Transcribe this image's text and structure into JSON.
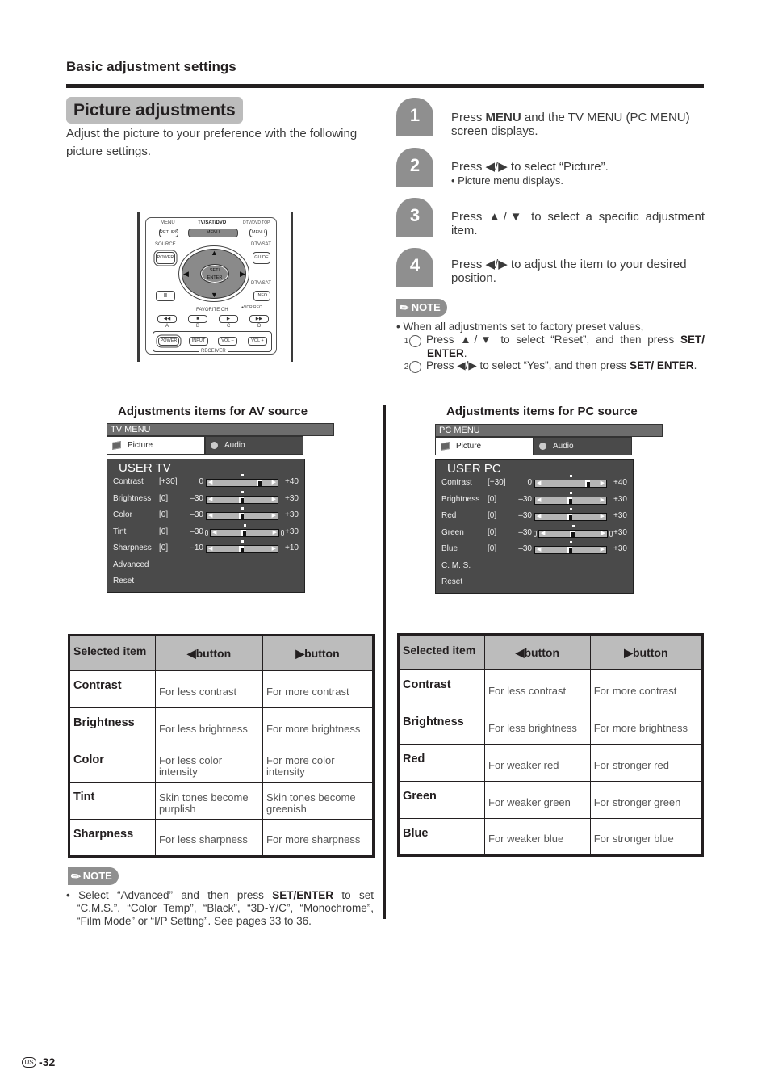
{
  "header": {
    "section_title": "Basic adjustment settings",
    "page_title": "Picture adjustments",
    "intro": "Adjust the picture to your preference with the following picture settings."
  },
  "remote": {
    "labels": {
      "menu_top": "MENU",
      "tvsatdvd": "TV/SAT/DVD",
      "dtvdvdtop": "DTV/DVD TOP",
      "source": "SOURCE",
      "dtvsat1": "DTV/SAT",
      "dtvsat2": "DTV/SAT",
      "favorite": "FAVORITE CH",
      "vcrrec": "●VCR REC",
      "a": "A",
      "b": "B",
      "c": "C",
      "d": "D",
      "receiver": "RECEIVER"
    },
    "buttons": {
      "return": "RETURN",
      "menu": "MENU",
      "menu_right": "MENU",
      "power_source": "POWER",
      "guide": "GUIDE",
      "set_enter": "SET/ ENTER",
      "pause": "II",
      "info": "INFO",
      "rew": "◀◀",
      "stop": "■",
      "play": "▶",
      "ff": "▶▶",
      "power_receiver": "POWER",
      "input": "INPUT",
      "vol_minus": "VOL –",
      "vol_plus": "VOL +",
      "up": "▲",
      "down": "▼",
      "left": "◀",
      "right": "▶"
    }
  },
  "steps": [
    {
      "num": "1",
      "pre": "Press ",
      "bold": "MENU",
      "post": " and the TV MENU (PC MENU) screen displays.",
      "sub": ""
    },
    {
      "num": "2",
      "pre": "Press ◀/▶ to select “Picture”.",
      "bold": "",
      "post": "",
      "sub": "• Picture menu displays."
    },
    {
      "num": "3",
      "pre": "Press ▲/▼ to select a specific adjustment item.",
      "bold": "",
      "post": "",
      "sub": ""
    },
    {
      "num": "4",
      "pre": "Press ◀/▶ to adjust the item to your desired position.",
      "bold": "",
      "post": "",
      "sub": ""
    }
  ],
  "note_top": {
    "badge": "NOTE",
    "intro": "• When all adjustments set to factory preset values,",
    "items": [
      {
        "num": "1",
        "pre": "Press ▲/▼ to select “Reset”, and then press ",
        "bold": "SET/ ENTER",
        "post": "."
      },
      {
        "num": "2",
        "pre": "Press ◀/▶ to select “Yes”, and then press ",
        "bold": "SET/ ENTER",
        "post": "."
      }
    ]
  },
  "av": {
    "heading": "Adjustments items for AV source",
    "menu": {
      "bar": "TV MENU",
      "tabs": [
        {
          "label": "Picture",
          "icon": "picture-icon",
          "active": true
        },
        {
          "label": "Audio",
          "icon": "audio-icon",
          "active": false
        }
      ],
      "mode": "USER TV",
      "sliders": [
        {
          "label": "Contrast",
          "bracket": "[+30]",
          "min": "0",
          "max": "+40",
          "value": 30,
          "range": [
            0,
            40
          ],
          "caps": false
        },
        {
          "label": "Brightness",
          "bracket": "[0]",
          "min": "–30",
          "max": "+30",
          "value": 0,
          "range": [
            -30,
            30
          ],
          "caps": false
        },
        {
          "label": "Color",
          "bracket": "[0]",
          "min": "–30",
          "max": "+30",
          "value": 0,
          "range": [
            -30,
            30
          ],
          "caps": false
        },
        {
          "label": "Tint",
          "bracket": "[0]",
          "min": "–30",
          "max": "+30",
          "value": 0,
          "range": [
            -30,
            30
          ],
          "caps": true
        },
        {
          "label": "Sharpness",
          "bracket": "[0]",
          "min": "–10",
          "max": "+10",
          "value": 0,
          "range": [
            -10,
            10
          ],
          "caps": false
        }
      ],
      "items": [
        "Advanced",
        "Reset"
      ]
    },
    "table": {
      "headers": [
        "Selected item",
        "◀button",
        "▶button"
      ],
      "rows": [
        [
          "Contrast",
          "For less contrast",
          "For more contrast"
        ],
        [
          "Brightness",
          "For less brightness",
          "For more brightness"
        ],
        [
          "Color",
          "For less color intensity",
          "For more color intensity"
        ],
        [
          "Tint",
          "Skin tones become purplish",
          "Skin tones become greenish"
        ],
        [
          "Sharpness",
          "For less sharpness",
          "For more sharpness"
        ]
      ]
    }
  },
  "pc": {
    "heading": "Adjustments items for PC source",
    "menu": {
      "bar": "PC MENU",
      "tabs": [
        {
          "label": "Picture",
          "icon": "picture-icon",
          "active": true
        },
        {
          "label": "Audio",
          "icon": "audio-icon",
          "active": false
        }
      ],
      "mode": "USER PC",
      "sliders": [
        {
          "label": "Contrast",
          "bracket": "[+30]",
          "min": "0",
          "max": "+40",
          "value": 30,
          "range": [
            0,
            40
          ],
          "caps": false
        },
        {
          "label": "Brightness",
          "bracket": "[0]",
          "min": "–30",
          "max": "+30",
          "value": 0,
          "range": [
            -30,
            30
          ],
          "caps": false
        },
        {
          "label": "Red",
          "bracket": "[0]",
          "min": "–30",
          "max": "+30",
          "value": 0,
          "range": [
            -30,
            30
          ],
          "caps": false
        },
        {
          "label": "Green",
          "bracket": "[0]",
          "min": "–30",
          "max": "+30",
          "value": 0,
          "range": [
            -30,
            30
          ],
          "caps": true
        },
        {
          "label": "Blue",
          "bracket": "[0]",
          "min": "–30",
          "max": "+30",
          "value": 0,
          "range": [
            -30,
            30
          ],
          "caps": false
        }
      ],
      "items": [
        "C. M. S.",
        "Reset"
      ]
    },
    "table": {
      "headers": [
        "Selected item",
        "◀button",
        "▶button"
      ],
      "rows": [
        [
          "Contrast",
          "For less contrast",
          "For more contrast"
        ],
        [
          "Brightness",
          "For less brightness",
          "For more brightness"
        ],
        [
          "Red",
          "For weaker red",
          "For stronger red"
        ],
        [
          "Green",
          "For weaker green",
          "For stronger green"
        ],
        [
          "Blue",
          "For weaker blue",
          "For stronger blue"
        ]
      ]
    }
  },
  "note_bottom": {
    "badge": "NOTE",
    "pre": "• Select “Advanced” and then press ",
    "bold": "SET/ENTER",
    "post": " to set “C.M.S.”, “Color Temp”, “Black”, “3D-Y/C”, “Monochrome”, “Film Mode” or “I/P Setting”. See pages 33 to 36."
  },
  "footer": {
    "region": "US",
    "page": "-32"
  },
  "colors": {
    "ink": "#231f20",
    "badge_gray": "#8f8f8f",
    "header_gray": "#bcbcbc",
    "osd_bg": "#4a4a4a"
  }
}
